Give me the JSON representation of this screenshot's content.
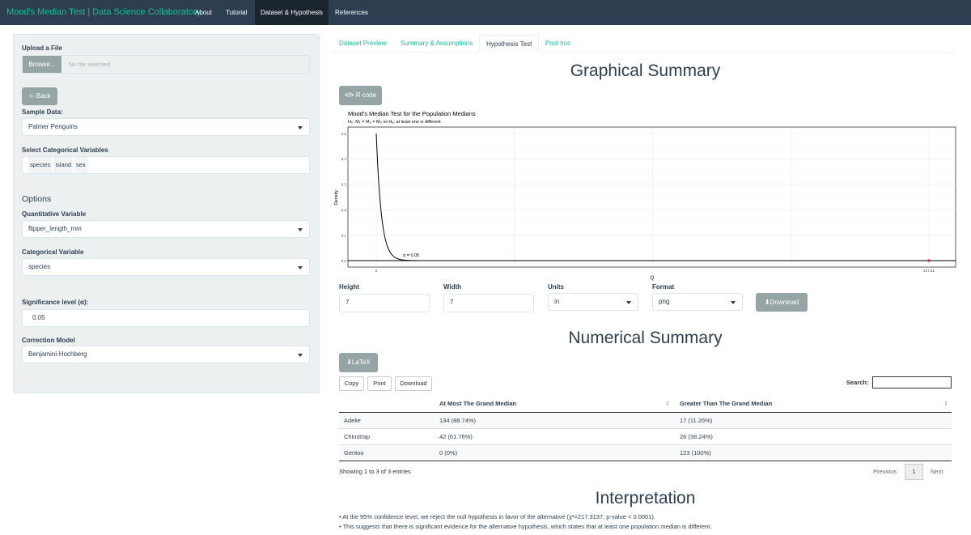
{
  "navbar": {
    "brand": "Mood's Median Test | Data Science Collaboratory",
    "links": [
      "About",
      "Tutorial",
      "Dataset & Hypothesis",
      "References"
    ]
  },
  "sidebar": {
    "upload_label": "Upload a File",
    "browse_label": "Browse...",
    "file_placeholder": "No file selected",
    "back_label": "<- Back",
    "sample_data_label": "Sample Data:",
    "sample_data_value": "Palmer Penguins",
    "cat_vars_label": "Select Categorical Variables",
    "cat_vars": [
      "species",
      "island",
      "sex"
    ],
    "options_heading": "Options",
    "quant_label": "Quantitative Variable",
    "quant_value": "flipper_length_mm",
    "cat_label": "Categorical Variable",
    "cat_value": "species",
    "sig_label": "Significance level (α):",
    "sig_value": "0.05",
    "correction_label": "Correction Model",
    "correction_value": "Benjamini-Hochberg"
  },
  "tabs": [
    "Dataset Preview",
    "Summary & Assumptions",
    "Hypothesis Test",
    "Post hoc"
  ],
  "graphical": {
    "heading": "Graphical Summary",
    "rcode_label": "R code",
    "height_label": "Height",
    "height_value": "7",
    "width_label": "Width",
    "width_value": "7",
    "units_label": "Units",
    "units_value": "in",
    "format_label": "Format",
    "format_value": "png",
    "download_label": "Download"
  },
  "chart_data": {
    "type": "line",
    "title": "Mood's Median Test for the Population Medians",
    "subtitle": "H₀: M₁ = M₂ = M₃ vs Hₐ: at least one is different",
    "xlabel": "Q",
    "ylabel": "Density",
    "yticks": [
      "0.0",
      "0.1",
      "0.2",
      "0.3",
      "0.4",
      "0.5"
    ],
    "xticks": [
      "0",
      "217.31"
    ],
    "ylim": [
      0,
      0.5
    ],
    "xlim": [
      0,
      217.31
    ],
    "curve": "chi-square density, df = 2",
    "annotation": "α = 0.05",
    "test_statistic": 217.31,
    "grid": true
  },
  "numerical": {
    "heading": "Numerical Summary",
    "latex_label": "LaTeX",
    "buttons": [
      "Copy",
      "Print",
      "Download"
    ],
    "search_label": "Search:",
    "columns": [
      "",
      "At Most The Grand Median",
      "Greater Than The Grand Median"
    ],
    "rows": [
      [
        "Adelie",
        "134 (88.74%)",
        "17 (11.26%)"
      ],
      [
        "Chinstrap",
        "42 (61.76%)",
        "26 (38.24%)"
      ],
      [
        "Gentoo",
        "0 (0%)",
        "123 (100%)"
      ]
    ],
    "info": "Showing 1 to 3 of 3 entries",
    "previous": "Previous",
    "page": "1",
    "next": "Next"
  },
  "interpretation": {
    "heading": "Interpretation",
    "line1": "• At the 95% confidence level, we reject the null hypothesis in favor of the alternative (χ²=217.3137, p-value < 0.0001).",
    "line2": "• This suggests that there is significant evidence for the alternative hypothesis, which states that at least one population median is different."
  }
}
